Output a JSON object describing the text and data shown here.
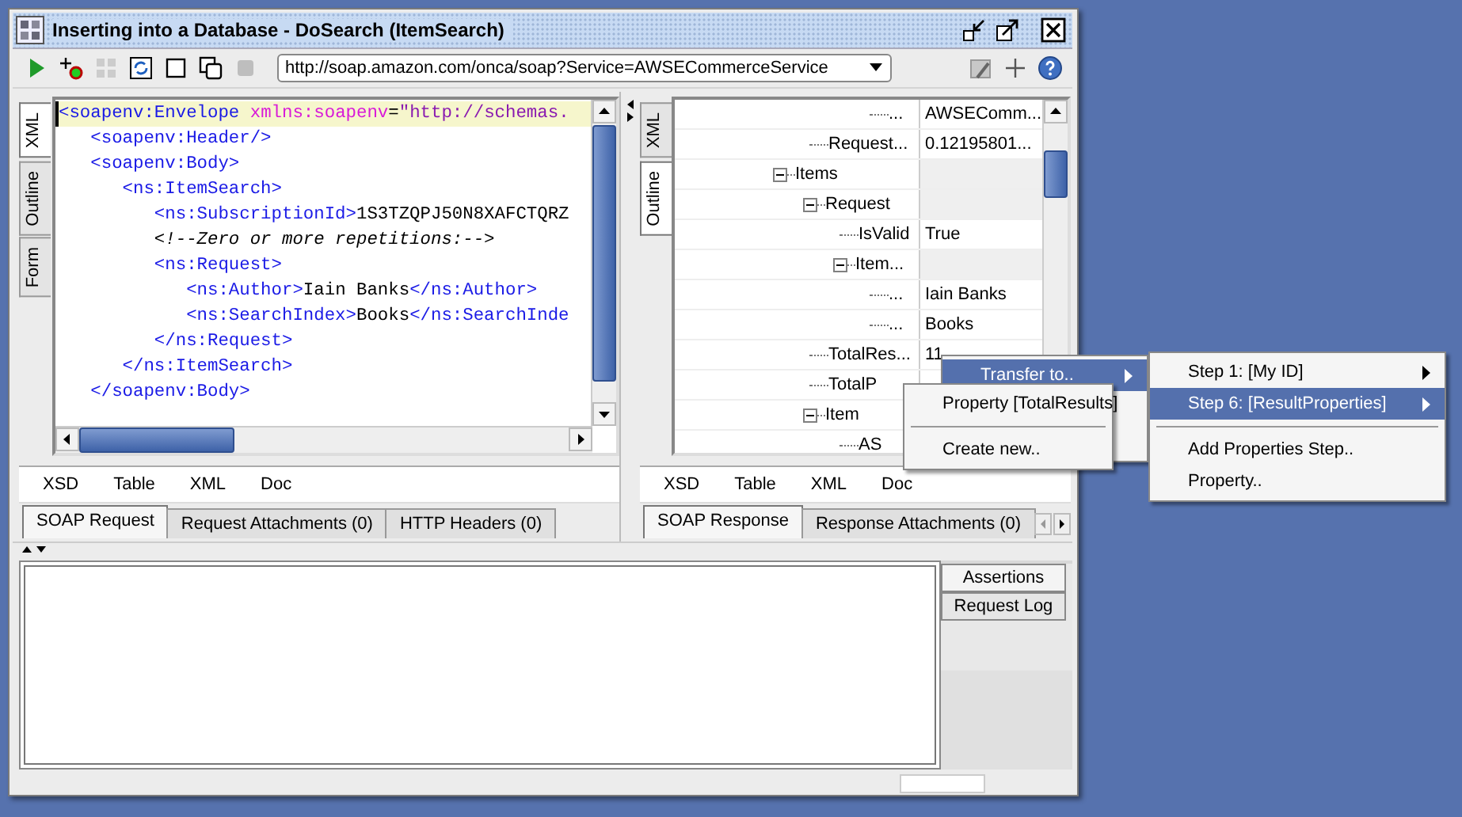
{
  "window": {
    "title": "Inserting into a Database - DoSearch (ItemSearch)"
  },
  "toolbar": {
    "buttons": [
      {
        "kind": "run",
        "disabled": false
      },
      {
        "kind": "add_assertion",
        "disabled": false
      },
      {
        "kind": "soap",
        "disabled": true
      },
      {
        "kind": "refresh",
        "disabled": false
      },
      {
        "kind": "square",
        "disabled": false
      },
      {
        "kind": "copy",
        "disabled": false
      },
      {
        "kind": "stop",
        "disabled": true
      }
    ],
    "endpoint": "http://soap.amazon.com/onca/soap?Service=AWSECommerceService",
    "tools": [
      {
        "kind": "options"
      },
      {
        "kind": "add"
      },
      {
        "kind": "help"
      }
    ]
  },
  "request_panel": {
    "side_tabs": [
      {
        "label": "XML",
        "selected": true
      },
      {
        "label": "Outline",
        "selected": false
      },
      {
        "label": "Form",
        "selected": false
      }
    ],
    "lines": [
      {
        "current": true,
        "segments": [
          {
            "kind": "tag",
            "text": "<soapenv:Envelope"
          },
          {
            "kind": "attr",
            "text": " xmlns:soapenv"
          },
          {
            "kind": "plain",
            "text": "="
          },
          {
            "kind": "value",
            "text": "\"http://schemas."
          }
        ]
      },
      {
        "current": false,
        "segments": [
          {
            "kind": "tag",
            "text": "   <soapenv:Header/>"
          }
        ]
      },
      {
        "current": false,
        "segments": [
          {
            "kind": "tag",
            "text": "   <soapenv:Body>"
          }
        ]
      },
      {
        "current": false,
        "segments": [
          {
            "kind": "tag",
            "text": "      <ns:ItemSearch>"
          }
        ]
      },
      {
        "current": false,
        "segments": [
          {
            "kind": "tag",
            "text": "         <ns:SubscriptionId>"
          },
          {
            "kind": "plain",
            "text": "1S3TZQPJ50N8XAFCTQRZ"
          }
        ]
      },
      {
        "current": false,
        "segments": [
          {
            "kind": "comment",
            "text": "         <!--Zero or more repetitions:-->"
          }
        ]
      },
      {
        "current": false,
        "segments": [
          {
            "kind": "tag",
            "text": "         <ns:Request>"
          }
        ]
      },
      {
        "current": false,
        "segments": [
          {
            "kind": "tag",
            "text": "            <ns:Author>"
          },
          {
            "kind": "plain",
            "text": "Iain Banks"
          },
          {
            "kind": "tag",
            "text": "</ns:Author>"
          }
        ]
      },
      {
        "current": false,
        "segments": [
          {
            "kind": "tag",
            "text": "            <ns:SearchIndex>"
          },
          {
            "kind": "plain",
            "text": "Books"
          },
          {
            "kind": "tag",
            "text": "</ns:SearchInde"
          }
        ]
      },
      {
        "current": false,
        "segments": [
          {
            "kind": "tag",
            "text": "         </ns:Request>"
          }
        ]
      },
      {
        "current": false,
        "segments": [
          {
            "kind": "tag",
            "text": "      </ns:ItemSearch>"
          }
        ]
      },
      {
        "current": false,
        "segments": [
          {
            "kind": "tag",
            "text": "   </soapenv:Body>"
          }
        ]
      }
    ],
    "view_tabs": [
      "XSD",
      "Table",
      "XML",
      "Doc"
    ],
    "tabs": [
      {
        "label": "SOAP Request",
        "selected": true
      },
      {
        "label": "Request Attachments (0)",
        "selected": false
      },
      {
        "label": "HTTP Headers (0)",
        "selected": false
      }
    ]
  },
  "response_panel": {
    "side_tabs": [
      {
        "label": "XML",
        "selected": false
      },
      {
        "label": "Outline",
        "selected": true
      }
    ],
    "tree": [
      {
        "children": [
          {
            "children": [
              {
                "children": [
                  {
                    "name": "...",
                    "value": "AWSEComm..."
                  }
                ]
              }
            ]
          },
          {
            "name": "Request...",
            "value": "0.12195801..."
          }
        ]
      },
      {
        "name": "Items",
        "expanded": true,
        "children": [
          {
            "name": "Request",
            "expanded": true,
            "children": [
              {
                "name": "IsValid",
                "value": "True"
              },
              {
                "name": "Item...",
                "expanded": true,
                "children": [
                  {
                    "name": "...",
                    "value": "Iain Banks"
                  },
                  {
                    "name": "...",
                    "value": "Books"
                  }
                ]
              }
            ]
          },
          {
            "name": "TotalRes...",
            "value": "11"
          },
          {
            "name": "TotalP"
          },
          {
            "name": "Item",
            "expanded": true,
            "children": [
              {
                "name": "AS"
              }
            ]
          }
        ]
      }
    ],
    "view_tabs": [
      "XSD",
      "Table",
      "XML",
      "Doc"
    ],
    "tabs": [
      {
        "label": "SOAP Response",
        "selected": true
      },
      {
        "label": "Response Attachments (0)",
        "selected": false
      }
    ]
  },
  "log_panel": {
    "side_tabs": [
      {
        "label": "Assertions",
        "selected": true
      },
      {
        "label": "Request Log",
        "selected": false
      }
    ]
  },
  "menus": [
    {
      "items": [
        {
          "kind": "item",
          "label": "Transfer to..",
          "submenu": true,
          "selected": true
        }
      ]
    },
    {
      "items": [
        {
          "kind": "item",
          "label": "Property [TotalResults]",
          "submenu": false,
          "selected": false
        },
        {
          "kind": "separator"
        },
        {
          "kind": "item",
          "label": "Create new..",
          "submenu": false,
          "selected": false
        }
      ]
    },
    {
      "items": [
        {
          "kind": "item",
          "label": "Step 1: [My ID]",
          "submenu": true,
          "selected": false
        },
        {
          "kind": "item",
          "label": "Step 6: [ResultProperties]",
          "submenu": true,
          "selected": true
        },
        {
          "kind": "separator"
        },
        {
          "kind": "item",
          "label": "Add Properties Step..",
          "submenu": false,
          "selected": false
        },
        {
          "kind": "item",
          "label": "Property..",
          "submenu": false,
          "selected": false
        }
      ]
    }
  ]
}
